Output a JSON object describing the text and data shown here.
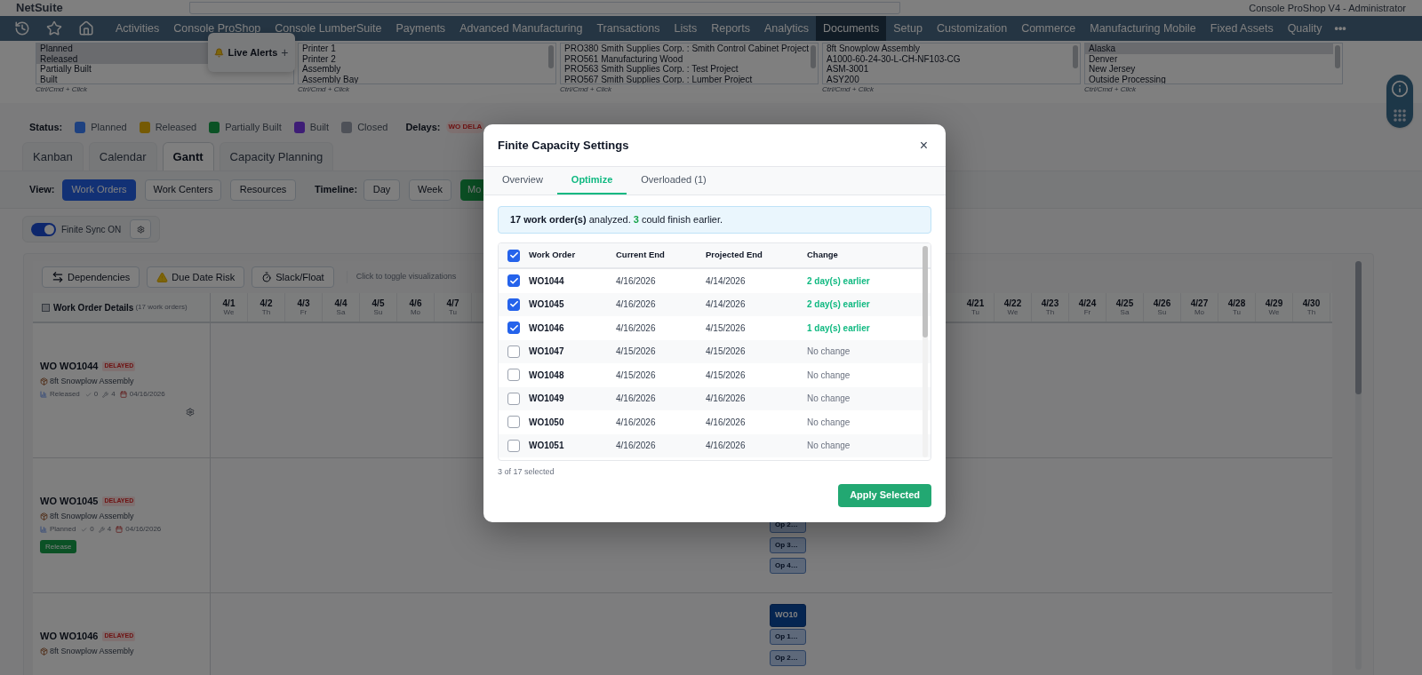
{
  "header": {
    "logo": "NetSuite",
    "account": "Console ProShop V4 - Administrator"
  },
  "nav": {
    "items": [
      {
        "label": "Activities",
        "selected": false
      },
      {
        "label": "Console ProShop",
        "selected": false
      },
      {
        "label": "Console LumberSuite",
        "selected": false
      },
      {
        "label": "Payments",
        "selected": false
      },
      {
        "label": "Advanced Manufacturing",
        "selected": false
      },
      {
        "label": "Transactions",
        "selected": false
      },
      {
        "label": "Lists",
        "selected": false
      },
      {
        "label": "Reports",
        "selected": false
      },
      {
        "label": "Analytics",
        "selected": false
      },
      {
        "label": "Documents",
        "selected": true
      },
      {
        "label": "Setup",
        "selected": false
      },
      {
        "label": "Customization",
        "selected": false
      },
      {
        "label": "Commerce",
        "selected": false
      },
      {
        "label": "Manufacturing Mobile",
        "selected": false
      },
      {
        "label": "Fixed Assets",
        "selected": false
      },
      {
        "label": "Quality",
        "selected": false
      }
    ],
    "more": "•••"
  },
  "live_alerts": {
    "label": "Live Alerts",
    "action": "+"
  },
  "filters": [
    {
      "options": [
        {
          "label": "Planned",
          "selected": true
        },
        {
          "label": "Released",
          "selected": true
        },
        {
          "label": "Partially Built",
          "selected": false
        },
        {
          "label": "Built",
          "selected": false
        }
      ],
      "hint": "Ctrl/Cmd + Click"
    },
    {
      "options": [
        {
          "label": "Printer 1",
          "selected": false
        },
        {
          "label": "Printer 2",
          "selected": false
        },
        {
          "label": "Assembly",
          "selected": false
        },
        {
          "label": "Assembly Bay",
          "selected": false
        }
      ],
      "hint": "Ctrl/Cmd + Click"
    },
    {
      "options": [
        {
          "label": "PRO380 Smith Supplies Corp. : Smith Control Cabinet Project",
          "selected": false
        },
        {
          "label": "PRO561 Manufacturing Wood",
          "selected": false
        },
        {
          "label": "PRO563 Smith Supplies Corp. : Test Project",
          "selected": false
        },
        {
          "label": "PRO567 Smith Supplies Corp. : Lumber Project",
          "selected": false
        }
      ],
      "hint": "Ctrl/Cmd + Click"
    },
    {
      "options": [
        {
          "label": "8ft Snowplow Assembly",
          "selected": false
        },
        {
          "label": "A1000-60-24-30-L-CH-NF103-CG",
          "selected": false
        },
        {
          "label": "ASM-3001",
          "selected": false
        },
        {
          "label": "ASY200",
          "selected": false
        }
      ],
      "hint": "Ctrl/Cmd + Click"
    },
    {
      "options": [
        {
          "label": "Alaska",
          "selected": true
        },
        {
          "label": "Denver",
          "selected": false
        },
        {
          "label": "New Jersey",
          "selected": false
        },
        {
          "label": "Outside Processing",
          "selected": false
        }
      ],
      "hint": "Ctrl/Cmd + Click"
    }
  ],
  "status_legend": {
    "label": "Status:",
    "items": [
      {
        "label": "Planned",
        "color": "#1e4180"
      },
      {
        "label": "Released",
        "color": "#755a04"
      },
      {
        "label": "Partially Built",
        "color": "#0b5225"
      },
      {
        "label": "Built",
        "color": "#3e1d76"
      },
      {
        "label": "Closed",
        "color": "#4e5158"
      }
    ]
  },
  "delays": {
    "label": "Delays:",
    "badge": "WO DELA"
  },
  "tabs": [
    {
      "label": "Kanban",
      "selected": false
    },
    {
      "label": "Calendar",
      "selected": false
    },
    {
      "label": "Gantt",
      "selected": true
    },
    {
      "label": "Capacity Planning",
      "selected": false
    }
  ],
  "view": {
    "label": "View:",
    "options": [
      {
        "label": "Work Orders",
        "selected": true
      },
      {
        "label": "Work Centers",
        "selected": false
      },
      {
        "label": "Resources",
        "selected": false
      }
    ]
  },
  "timeline": {
    "label": "Timeline:",
    "options": [
      {
        "label": "Day",
        "selected": false
      },
      {
        "label": "Week",
        "selected": false
      },
      {
        "label": "Mo",
        "selected": true
      }
    ]
  },
  "finite_sync": {
    "label": "Finite Sync ON",
    "on": true
  },
  "gantt": {
    "tools": [
      {
        "label": "Dependencies",
        "kind": "arrows"
      },
      {
        "label": "Due Date Risk",
        "kind": "warning"
      },
      {
        "label": "Slack/Float",
        "kind": "timer"
      }
    ],
    "hint": "Click to toggle visualizations",
    "select_all": false,
    "details_heading": "Work Order Details",
    "details_count": "(17 work orders)",
    "dates_before": [
      {
        "date": "4/1",
        "day": "We"
      },
      {
        "date": "4/2",
        "day": "Th"
      },
      {
        "date": "4/3",
        "day": "Fr"
      },
      {
        "date": "4/4",
        "day": "Sa"
      },
      {
        "date": "4/5",
        "day": "Su"
      },
      {
        "date": "4/6",
        "day": "Mo"
      },
      {
        "date": "4/7",
        "day": "Tu"
      }
    ],
    "dates_after": [
      {
        "date": "4/21",
        "day": "Tu"
      },
      {
        "date": "4/22",
        "day": "We"
      },
      {
        "date": "4/23",
        "day": "Th"
      },
      {
        "date": "4/24",
        "day": "Fr"
      },
      {
        "date": "4/25",
        "day": "Sa"
      },
      {
        "date": "4/26",
        "day": "Su"
      },
      {
        "date": "4/27",
        "day": "Mo"
      },
      {
        "date": "4/28",
        "day": "Tu"
      },
      {
        "date": "4/29",
        "day": "We"
      },
      {
        "date": "4/30",
        "day": "Th"
      }
    ],
    "rows": [
      {
        "title": "WO WO1044",
        "badge": "DELAYED",
        "item": "8ft Snowplow Assembly",
        "meta": {
          "status": "Released",
          "done": "0",
          "ops": "4",
          "due": "04/16/2026"
        },
        "settings_icon": true,
        "bars": []
      },
      {
        "title": "WO WO1045",
        "badge": "DELAYED",
        "item": "8ft Snowplow Assembly",
        "meta": {
          "status": "Planned",
          "done": "0",
          "ops": "4",
          "due": "04/16/2026"
        },
        "action": "Release",
        "settings_icon": false,
        "bars": [
          {
            "label": "Op 2…",
            "kind": "op"
          },
          {
            "label": "Op 3…",
            "kind": "op"
          },
          {
            "label": "Op 4…",
            "kind": "op"
          }
        ]
      },
      {
        "title": "WO WO1046",
        "badge": "DELAYED",
        "item": "8ft Snowplow Assembly",
        "bars": [
          {
            "label": "WO10",
            "kind": "wo"
          },
          {
            "label": "Op 1…",
            "kind": "op"
          },
          {
            "label": "Op 2…",
            "kind": "op"
          }
        ]
      }
    ]
  },
  "modal": {
    "title": "Finite Capacity Settings",
    "close": "×",
    "tabs": [
      {
        "label": "Overview",
        "selected": false
      },
      {
        "label": "Optimize",
        "selected": true
      },
      {
        "label": "Overloaded (1)",
        "selected": false
      }
    ],
    "summary": {
      "bold": "17 work order(s)",
      "text1": " analyzed. ",
      "count": "3",
      "text2": " could finish earlier."
    },
    "columns": [
      "Work Order",
      "Current End",
      "Projected End",
      "Change"
    ],
    "all_checked": true,
    "rows": [
      {
        "checked": true,
        "work_order": "WO1044",
        "current_end": "4/16/2026",
        "projected_end": "4/14/2026",
        "change": "2 day(s) earlier",
        "kind": "earlier"
      },
      {
        "checked": true,
        "work_order": "WO1045",
        "current_end": "4/16/2026",
        "projected_end": "4/14/2026",
        "change": "2 day(s) earlier",
        "kind": "earlier"
      },
      {
        "checked": true,
        "work_order": "WO1046",
        "current_end": "4/16/2026",
        "projected_end": "4/15/2026",
        "change": "1 day(s) earlier",
        "kind": "earlier"
      },
      {
        "checked": false,
        "work_order": "WO1047",
        "current_end": "4/15/2026",
        "projected_end": "4/15/2026",
        "change": "No change",
        "kind": "none"
      },
      {
        "checked": false,
        "work_order": "WO1048",
        "current_end": "4/15/2026",
        "projected_end": "4/15/2026",
        "change": "No change",
        "kind": "none"
      },
      {
        "checked": false,
        "work_order": "WO1049",
        "current_end": "4/16/2026",
        "projected_end": "4/16/2026",
        "change": "No change",
        "kind": "none"
      },
      {
        "checked": false,
        "work_order": "WO1050",
        "current_end": "4/16/2026",
        "projected_end": "4/16/2026",
        "change": "No change",
        "kind": "none"
      },
      {
        "checked": false,
        "work_order": "WO1051",
        "current_end": "4/16/2026",
        "projected_end": "4/16/2026",
        "change": "No change",
        "kind": "none"
      }
    ],
    "selection_count": "3 of 17 selected",
    "apply": "Apply Selected"
  }
}
